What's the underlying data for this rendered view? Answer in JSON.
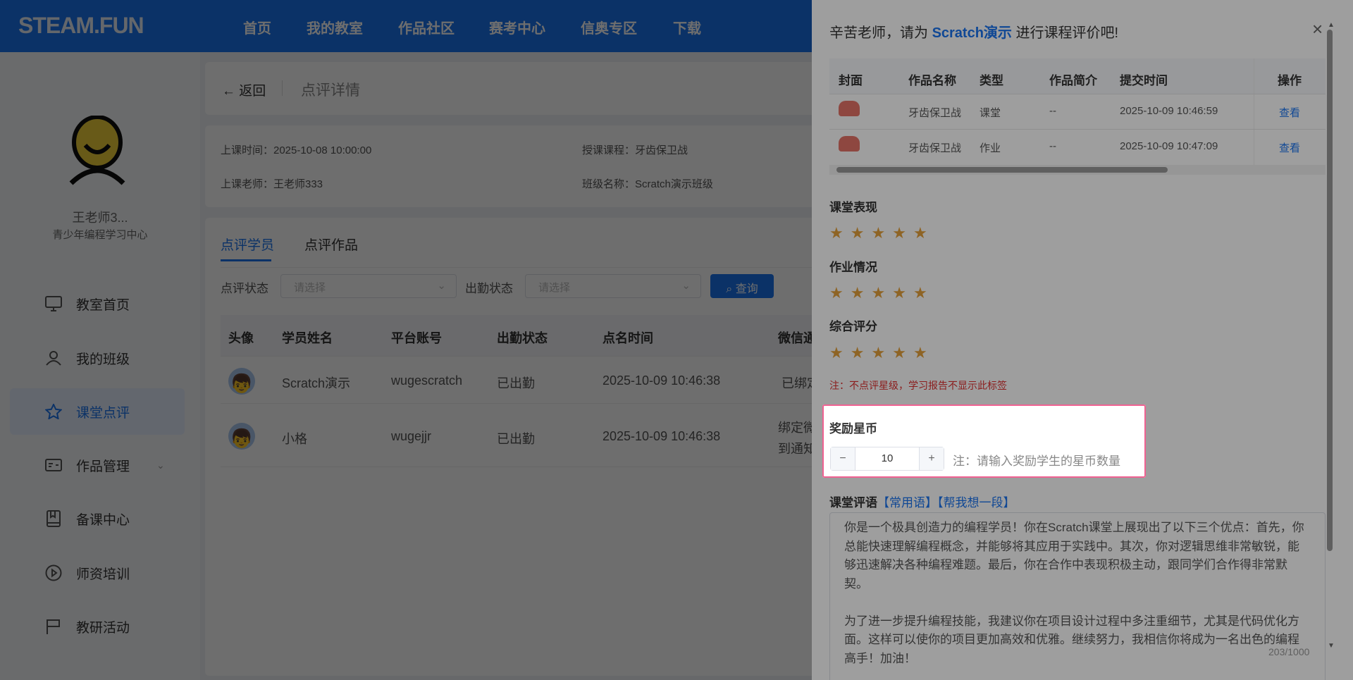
{
  "header": {
    "logo": "STEAM.FUN",
    "nav": [
      "首页",
      "我的教室",
      "作品社区",
      "赛考中心",
      "信奥专区",
      "下载"
    ]
  },
  "sidebar": {
    "user_name": "王老师3...",
    "org": "青少年编程学习中心",
    "items": [
      {
        "label": "教室首页",
        "icon": "monitor-icon"
      },
      {
        "label": "我的班级",
        "icon": "user-icon"
      },
      {
        "label": "课堂点评",
        "icon": "star-icon",
        "active": true
      },
      {
        "label": "作品管理",
        "icon": "card-icon"
      },
      {
        "label": "备课中心",
        "icon": "book-icon"
      },
      {
        "label": "师资培训",
        "icon": "play-icon"
      },
      {
        "label": "教研活动",
        "icon": "flag-icon"
      }
    ]
  },
  "page": {
    "back": "返回",
    "title": "点评详情",
    "info": {
      "time": "上课时间：2025-10-08 10:00:00",
      "course": "授课课程：牙齿保卫战",
      "teacher": "上课老师：王老师333",
      "class": "班级名称：Scratch演示班级"
    },
    "tabs": [
      "点评学员",
      "点评作品"
    ],
    "filters": {
      "review_label": "点评状态",
      "attend_label": "出勤状态",
      "placeholder": "请选择",
      "query": "查询"
    },
    "table": {
      "headers": [
        "头像",
        "学员姓名",
        "平台账号",
        "出勤状态",
        "点名时间",
        "微信通"
      ],
      "rows": [
        {
          "name": "Scratch演示",
          "account": "wugescratch",
          "status": "已出勤",
          "time": "2025-10-09 10:46:38",
          "wechat": "已绑定"
        },
        {
          "name": "小格",
          "account": "wugejjr",
          "status": "已出勤",
          "time": "2025-10-09 10:46:38",
          "wechat": "绑定微",
          "wechat2": "到通知"
        }
      ]
    }
  },
  "drawer": {
    "title_pre": "辛苦老师，请为",
    "student": "Scratch演示",
    "title_post": "进行课程评价吧!",
    "close": "×",
    "table": {
      "headers": [
        "封面",
        "作品名称",
        "类型",
        "作品简介",
        "提交时间",
        "操作"
      ],
      "rows": [
        {
          "name": "牙齿保卫战",
          "type": "课堂",
          "intro": "--",
          "time": "2025-10-09 10:46:59",
          "action": "查看"
        },
        {
          "name": "牙齿保卫战",
          "type": "作业",
          "intro": "--",
          "time": "2025-10-09 10:47:09",
          "action": "查看"
        }
      ]
    },
    "ratings": [
      {
        "label": "课堂表现",
        "stars": 5
      },
      {
        "label": "作业情况",
        "stars": 5
      },
      {
        "label": "综合评分",
        "stars": 5
      }
    ],
    "rating_note": "注：不点评星级，学习报告不显示此标签",
    "reward": {
      "label": "奖励星币",
      "value": "10",
      "minus": "−",
      "plus": "+",
      "note": "注：请输入奖励学生的星币数量"
    },
    "comment": {
      "label": "课堂评语",
      "link1": "【常用语】",
      "link2": "【帮我想一段】",
      "para1": "你是一个极具创造力的编程学员！你在Scratch课堂上展现出了以下三个优点：首先，你总能快速理解编程概念，并能够将其应用于实践中。其次，你对逻辑思维非常敏锐，能够迅速解决各种编程难题。最后，你在合作中表现积极主动，跟同学们合作得非常默契。",
      "para2": "为了进一步提升编程技能，我建议你在项目设计过程中多注重细节，尤其是代码优化方面。这样可以使你的项目更加高效和优雅。继续努力，我相信你将成为一名出色的编程高手！加油！",
      "counter": "203/1000"
    }
  },
  "colors": {
    "accent": "#1a74f0",
    "star": "#e6a23c",
    "tour_border": "#f06292"
  }
}
